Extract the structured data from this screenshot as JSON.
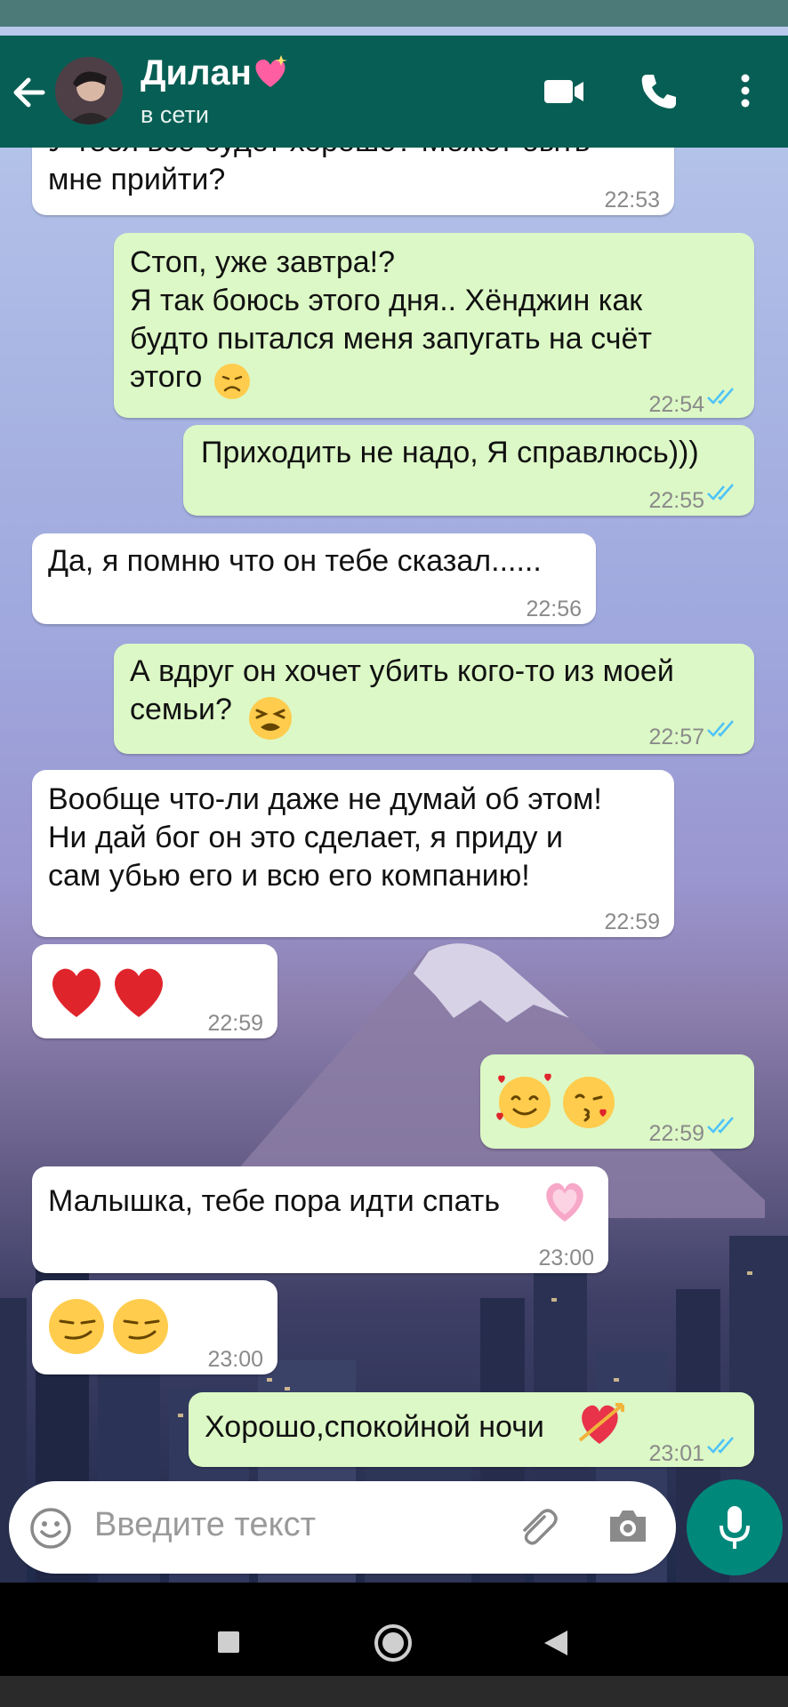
{
  "header": {
    "contact_name": "Дилан",
    "contact_status": "в сети",
    "icons": [
      "back-arrow-icon",
      "avatar",
      "heart-emoji",
      "video-call-icon",
      "phone-call-icon",
      "more-vert-icon"
    ]
  },
  "messages": [
    {
      "dir": "in",
      "text": "У тебя всё будет хорошо? Может быть\nмне прийти?",
      "time": "22:53"
    },
    {
      "dir": "out",
      "text": "Стоп, уже завтра!?\nЯ так боюсь этого дня.. Хёнджин как\nбудто пытался меня запугать на счёт\nэтого",
      "time": "22:54"
    },
    {
      "dir": "out",
      "text": "Приходить не надо, Я справлюсь)))",
      "time": "22:55"
    },
    {
      "dir": "in",
      "text": "Да, я помню что он тебе сказал......",
      "time": "22:56"
    },
    {
      "dir": "out",
      "text": "А вдруг он хочет убить кого-то из моей\nсемьи?",
      "time": "22:57"
    },
    {
      "dir": "in",
      "text": "Вообще что-ли даже не думай об этом!\nНи дай бог он это сделает, я приду и\nсам убью его и всю его компанию!",
      "time": "22:59"
    },
    {
      "dir": "in",
      "text": "",
      "time": "22:59"
    },
    {
      "dir": "out",
      "text": "",
      "time": "22:59"
    },
    {
      "dir": "in",
      "text": "Малышка, тебе пора идти спать",
      "time": "23:00"
    },
    {
      "dir": "in",
      "text": "",
      "time": "23:00"
    },
    {
      "dir": "out",
      "text": "Хорошо,спокойной ночи",
      "time": "23:01"
    }
  ],
  "input": {
    "placeholder": "Введите текст",
    "icons": [
      "emoji-icon",
      "attach-icon",
      "camera-icon",
      "mic-icon"
    ]
  },
  "navbar": {
    "icons": [
      "recent-apps-icon",
      "home-icon",
      "back-icon"
    ]
  },
  "colors": {
    "header": "#075e54",
    "outgoing_bubble": "#dcf8c6",
    "incoming_bubble": "#ffffff",
    "read_ticks": "#4fc3f7",
    "mic_button": "#00897b"
  }
}
